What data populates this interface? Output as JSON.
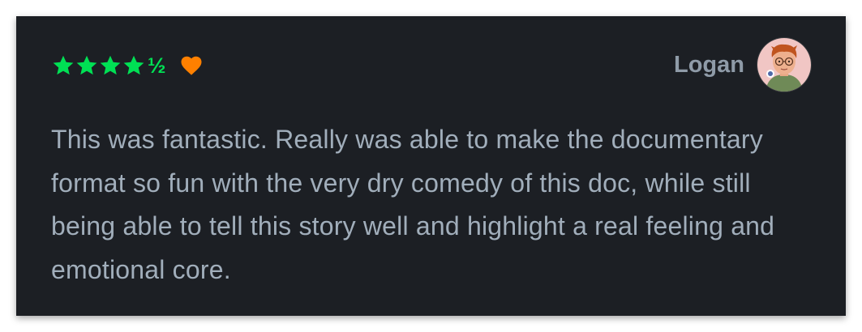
{
  "review": {
    "rating_display": "★★★★½",
    "half_glyph": "½",
    "liked": true,
    "author": "Logan",
    "body": "This was fantastic. Really was able to make the documentary format so fun with the very dry comedy of this doc, while still being able to tell this story well and highlight a real feeling and emotional core."
  },
  "icons": {
    "star": "star-icon",
    "heart": "heart-icon",
    "avatar": "user-avatar"
  },
  "colors": {
    "background": "#1c1f24",
    "star": "#00e054",
    "heart": "#ff8000",
    "text": "#a1aebb",
    "username": "#8f9ba8"
  }
}
